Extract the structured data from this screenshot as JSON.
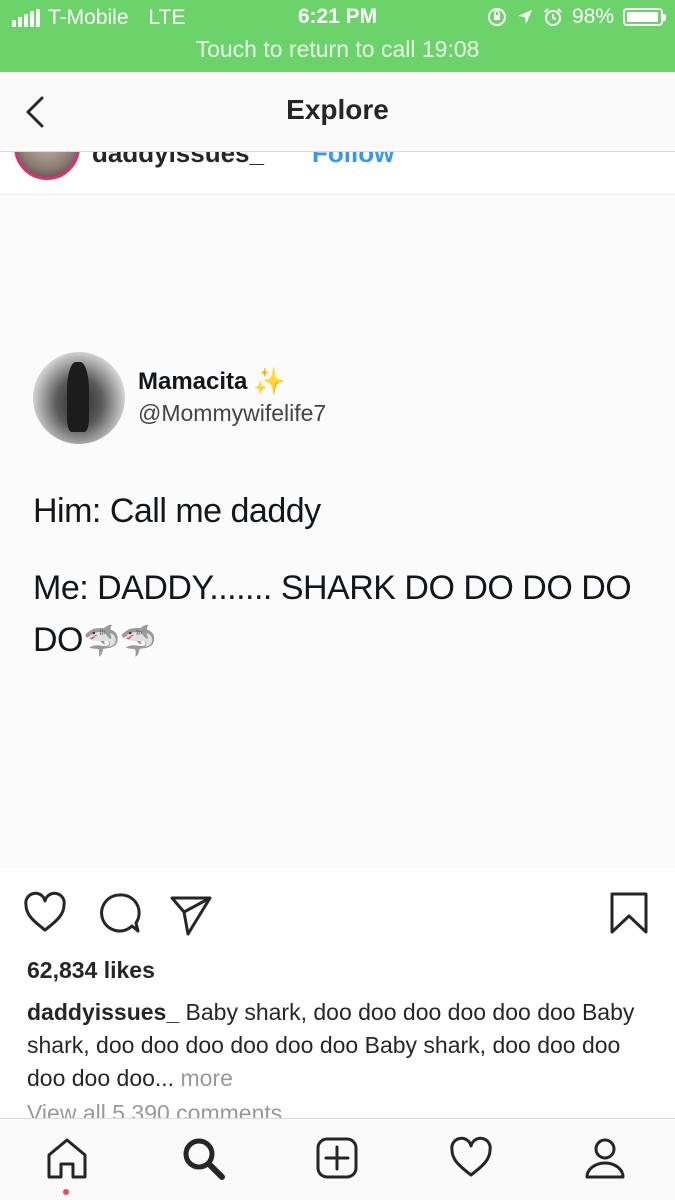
{
  "status_bar": {
    "carrier": "T-Mobile",
    "network": "LTE",
    "time": "6:21 PM",
    "battery_percent": "98%",
    "battery_level": 0.98,
    "icons": [
      "signal-icon",
      "orientation-lock-icon",
      "location-icon",
      "alarm-icon",
      "battery-icon"
    ]
  },
  "call_banner": {
    "text": "Touch to return to call 19:08"
  },
  "nav": {
    "title": "Explore",
    "back_icon": "chevron-left-icon"
  },
  "post": {
    "username": "daddyissues_",
    "follow_label": "Follow",
    "image": {
      "tweet_name": "Mamacita",
      "tweet_handle": "@Mommywifelife7",
      "tweet_line1": "Him: Call me daddy",
      "tweet_line2": "Me: DADDY....... SHARK DO DO DO DO DO",
      "tweet_emoji": "🦈🦈"
    },
    "likes": "62,834 likes",
    "caption_user": "daddyissues_",
    "caption_text": "Baby shark, doo doo doo doo doo doo Baby shark, doo doo doo doo doo doo Baby shark, doo doo doo doo doo doo...",
    "more_label": "more",
    "view_comments": "View all 5,390 comments"
  },
  "tabbar": {
    "items": [
      "home-icon",
      "search-icon",
      "add-post-icon",
      "activity-heart-icon",
      "profile-icon"
    ]
  },
  "colors": {
    "call_banner_green": "#6bd36a",
    "follow_blue": "#3897f0",
    "notification_red": "#ed4956"
  }
}
